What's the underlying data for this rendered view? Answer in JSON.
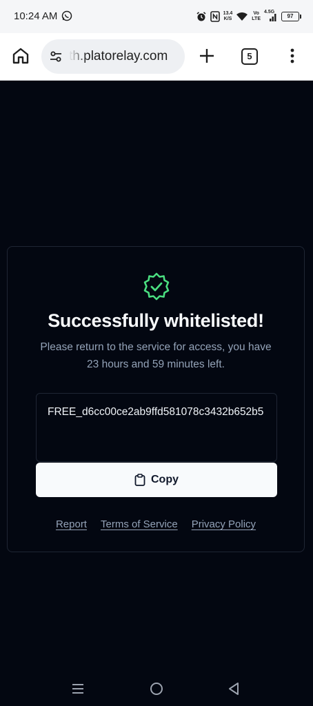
{
  "status_bar": {
    "time": "10:24 AM",
    "net_speed_value": "13.4",
    "net_speed_unit": "K/S",
    "volte_top": "Vo",
    "volte_bottom": "LTE",
    "network_type": "4.5G",
    "battery": "97",
    "icons": [
      "whatsapp-icon",
      "alarm-icon",
      "nfc-icon",
      "wifi-icon",
      "signal-icon",
      "battery-icon"
    ]
  },
  "browser": {
    "url": "th.platorelay.com",
    "tab_count": "5",
    "icons": [
      "home-icon",
      "tune-icon",
      "plus-icon",
      "tabs-icon",
      "menu-dots-icon"
    ]
  },
  "card": {
    "title": "Successfully whitelisted!",
    "description": "Please return to the service for access, you have 23 hours and 59 minutes left.",
    "key": "FREE_d6cc00ce2ab9ffd581078c3432b652b5",
    "copy_label": "Copy",
    "links": {
      "report": "Report",
      "terms": "Terms of Service",
      "privacy": "Privacy Policy"
    },
    "icons": [
      "verified-badge-icon",
      "clipboard-icon"
    ]
  },
  "colors": {
    "background": "#030711",
    "badge_green": "#4ade80",
    "title_text": "#f8fafc",
    "muted_text": "#94a3b8",
    "border": "#1f2634",
    "button_bg": "#f8fafc"
  },
  "nav_bar": {
    "icons": [
      "recents-icon",
      "home-circle-icon",
      "back-icon"
    ]
  }
}
